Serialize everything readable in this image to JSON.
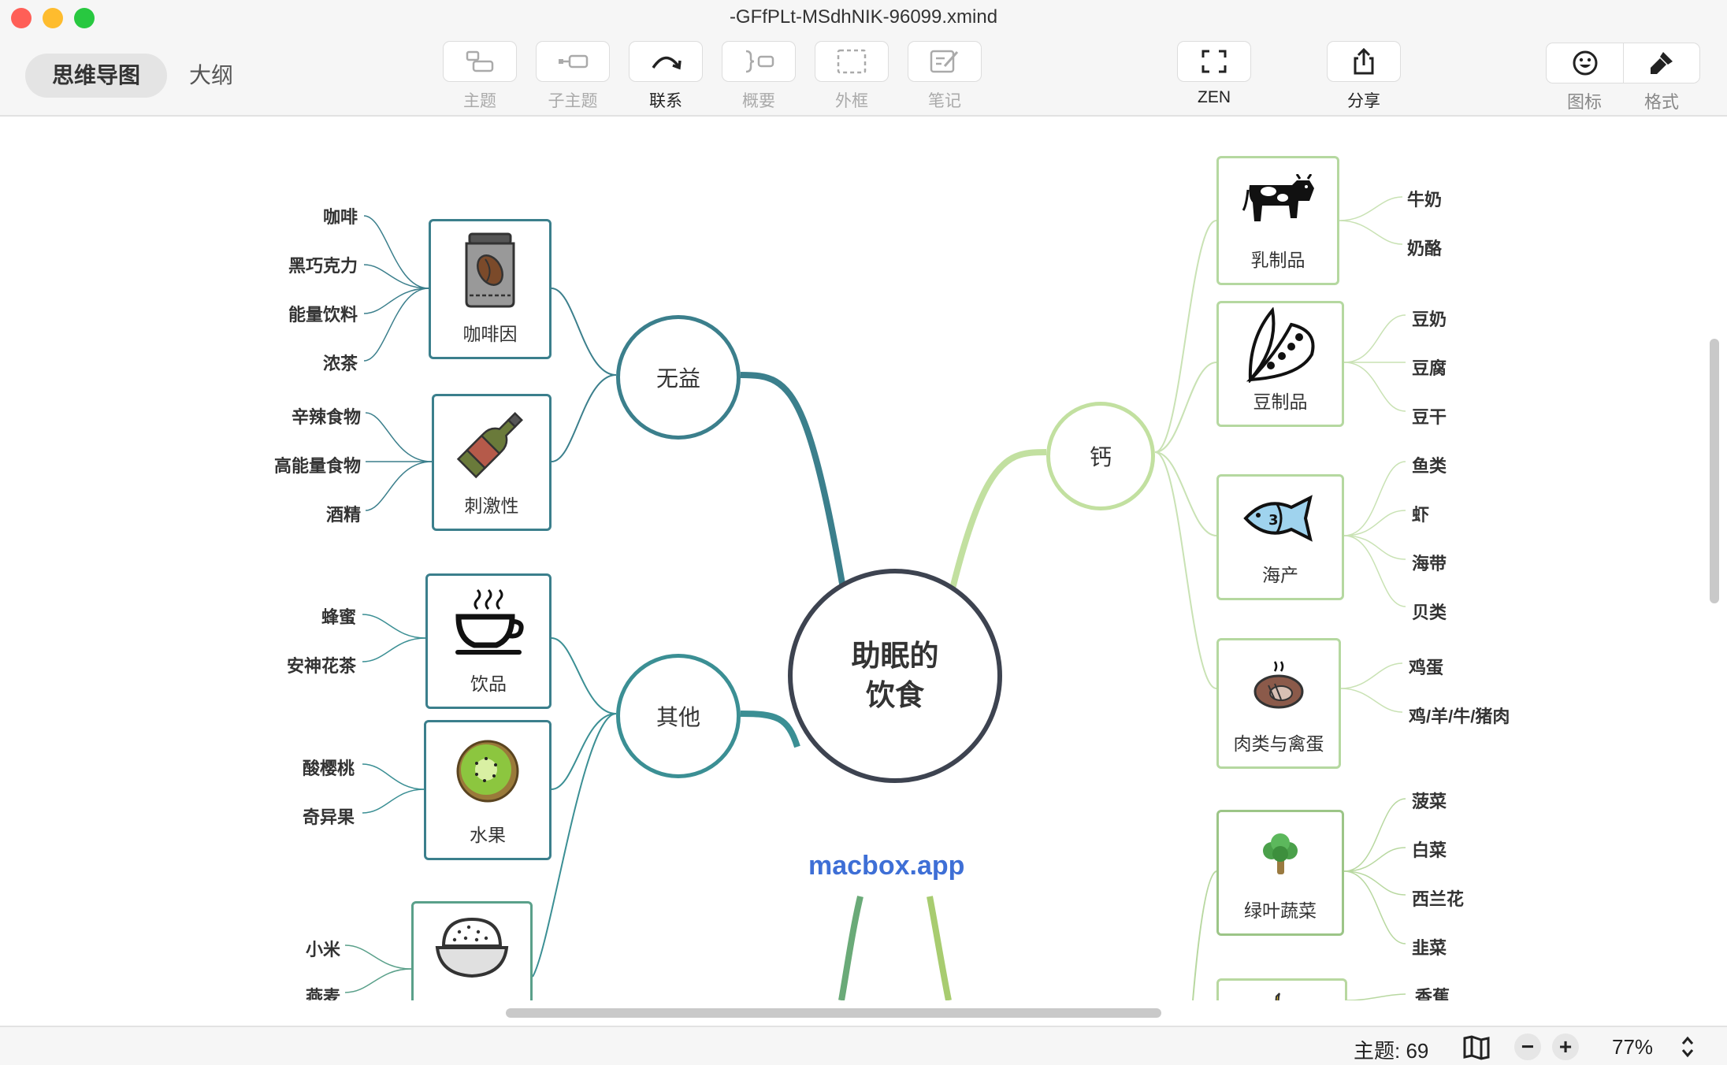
{
  "window": {
    "title": "-GFfPLt-MSdhNIK-96099.xmind",
    "traffic_colors": [
      "#ff5f57",
      "#febc2e",
      "#28c840"
    ]
  },
  "view_tabs": {
    "mindmap": "思维导图",
    "outline": "大纲"
  },
  "toolbar": {
    "topic": "主题",
    "subtopic": "子主题",
    "relation": "联系",
    "summary": "概要",
    "boundary": "外框",
    "note": "笔记",
    "zen": "ZEN",
    "share": "分享",
    "icon": "图标",
    "format": "格式"
  },
  "mindmap": {
    "central": {
      "line1": "助眠的",
      "line2": "饮食"
    },
    "branches": {
      "useless": {
        "label": "无益",
        "children": [
          {
            "label": "咖啡因",
            "icon": "coffee-jar-icon",
            "leaves": [
              "咖啡",
              "黑巧克力",
              "能量饮料",
              "浓茶"
            ]
          },
          {
            "label": "刺激性",
            "icon": "wine-bottle-icon",
            "leaves": [
              "辛辣食物",
              "高能量食物",
              "酒精"
            ]
          }
        ]
      },
      "other": {
        "label": "其他",
        "children": [
          {
            "label": "饮品",
            "icon": "hot-cup-icon",
            "leaves": [
              "蜂蜜",
              "安神花茶"
            ]
          },
          {
            "label": "水果",
            "icon": "kiwi-icon",
            "leaves": [
              "酸樱桃",
              "奇异果"
            ]
          },
          {
            "label": "",
            "icon": "rice-bowl-icon",
            "leaves": [
              "小米",
              "燕麦"
            ]
          }
        ]
      },
      "calcium": {
        "label": "钙",
        "children": [
          {
            "label": "乳制品",
            "icon": "cow-icon",
            "leaves": [
              "牛奶",
              "奶酪"
            ]
          },
          {
            "label": "豆制品",
            "icon": "pea-pod-icon",
            "leaves": [
              "豆奶",
              "豆腐",
              "豆干"
            ]
          },
          {
            "label": "海产",
            "icon": "fish-icon",
            "leaves": [
              "鱼类",
              "虾",
              "海带",
              "贝类"
            ]
          },
          {
            "label": "肉类与禽蛋",
            "icon": "steak-icon",
            "leaves": [
              "鸡蛋",
              "鸡/羊/牛/猪肉"
            ]
          }
        ]
      },
      "lower_right": {
        "children": [
          {
            "label": "绿叶蔬菜",
            "icon": "broccoli-icon",
            "leaves": [
              "菠菜",
              "白菜",
              "西兰花",
              "韭菜"
            ]
          },
          {
            "label": "",
            "icon": "banana-icon",
            "leaves": [
              "香蕉"
            ]
          }
        ]
      }
    },
    "colors": {
      "teal": "#3b7f8c",
      "light_green": "#b8dc9a",
      "central_border": "#3d4350"
    }
  },
  "watermark": "macbox.app",
  "status": {
    "topics": "主题: 69",
    "zoom": "77%"
  }
}
